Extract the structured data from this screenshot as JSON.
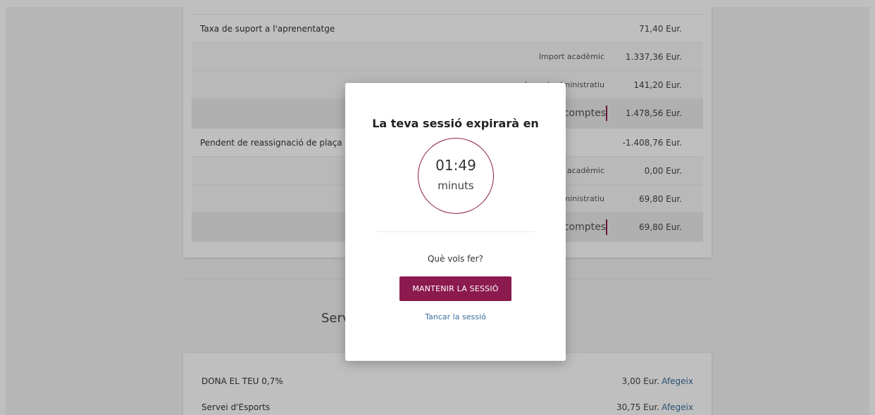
{
  "fees": {
    "top_rows": [
      {
        "label": "Taxa de suport a l'aprenentatge",
        "amount": "71,40 Eur."
      }
    ],
    "sub_rows_1": [
      {
        "label": "Import acadèmic",
        "amount": "1.337,36 Eur."
      },
      {
        "label": "Import administratiu",
        "amount": "141,20 Eur."
      }
    ],
    "total_1": {
      "label": "Total descomptes",
      "amount": "1.478,56 Eur."
    },
    "reassign_row": {
      "label": "Pendent de reassignació de plaça",
      "amount": "-1.408,76 Eur."
    },
    "sub_rows_2": [
      {
        "label": "Import acadèmic",
        "amount": "0,00 Eur."
      },
      {
        "label": "Import administratiu",
        "amount": "69,80 Eur."
      }
    ],
    "total_2": {
      "label": "Total descomptes",
      "amount": "69,80 Eur."
    }
  },
  "services": {
    "section_title": "Serveis opcionals",
    "rows": [
      {
        "label": "DONA EL TEU 0,7%",
        "amount": "3,00 Eur.",
        "action": "Afegeix"
      },
      {
        "label": "Servei d'Esports",
        "amount": "30,75 Eur.",
        "action": "Afegeix"
      }
    ]
  },
  "modal": {
    "title": "La teva sessió expirarà en",
    "timer_value": "01:49",
    "timer_unit": "minuts",
    "question": "Què vols fer?",
    "keep_label": "MANTENIR LA SESSIÓ",
    "logout_label": "Tancar la sessió"
  },
  "colors": {
    "accent": "#8b1a4e",
    "link": "#3a6d99"
  }
}
